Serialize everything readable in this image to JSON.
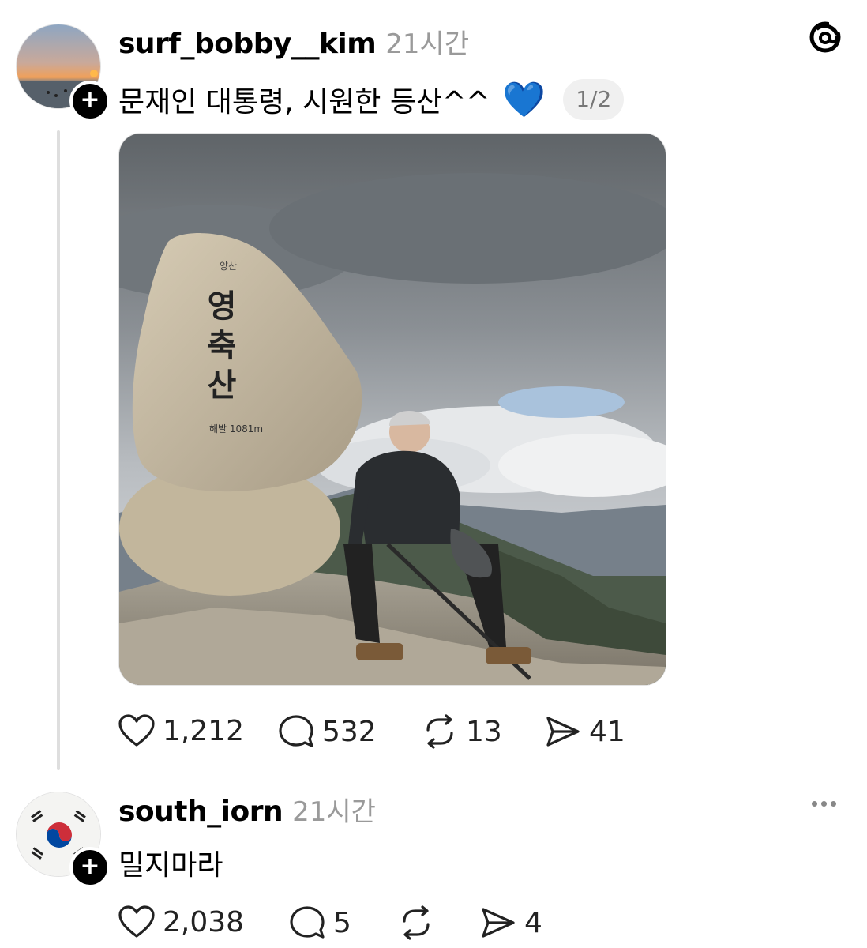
{
  "post": {
    "username": "surf_bobby__kim",
    "time": "21시간",
    "text": "문재인 대통령, 시원한 등산^^",
    "emoji": "💙",
    "pager": "1/2",
    "photo": {
      "stone_text": [
        "영",
        "축",
        "산"
      ],
      "stone_logo": "양산",
      "stone_elevation": "해발 1081m"
    },
    "stats": {
      "likes": "1,212",
      "replies": "532",
      "reposts": "13",
      "shares": "41"
    }
  },
  "reply": {
    "username": "south_iorn",
    "time": "21시간",
    "text": "밀지마라",
    "stats": {
      "likes": "2,038",
      "replies": "5",
      "reposts": "",
      "shares": "4"
    }
  },
  "colors": {
    "accent": "#000000",
    "muted": "#9a9a9a",
    "heart": "#3a7bd5"
  },
  "icons": [
    "threads-logo-icon",
    "heart-icon",
    "comment-icon",
    "repost-icon",
    "share-icon",
    "more-icon",
    "plus-icon"
  ]
}
